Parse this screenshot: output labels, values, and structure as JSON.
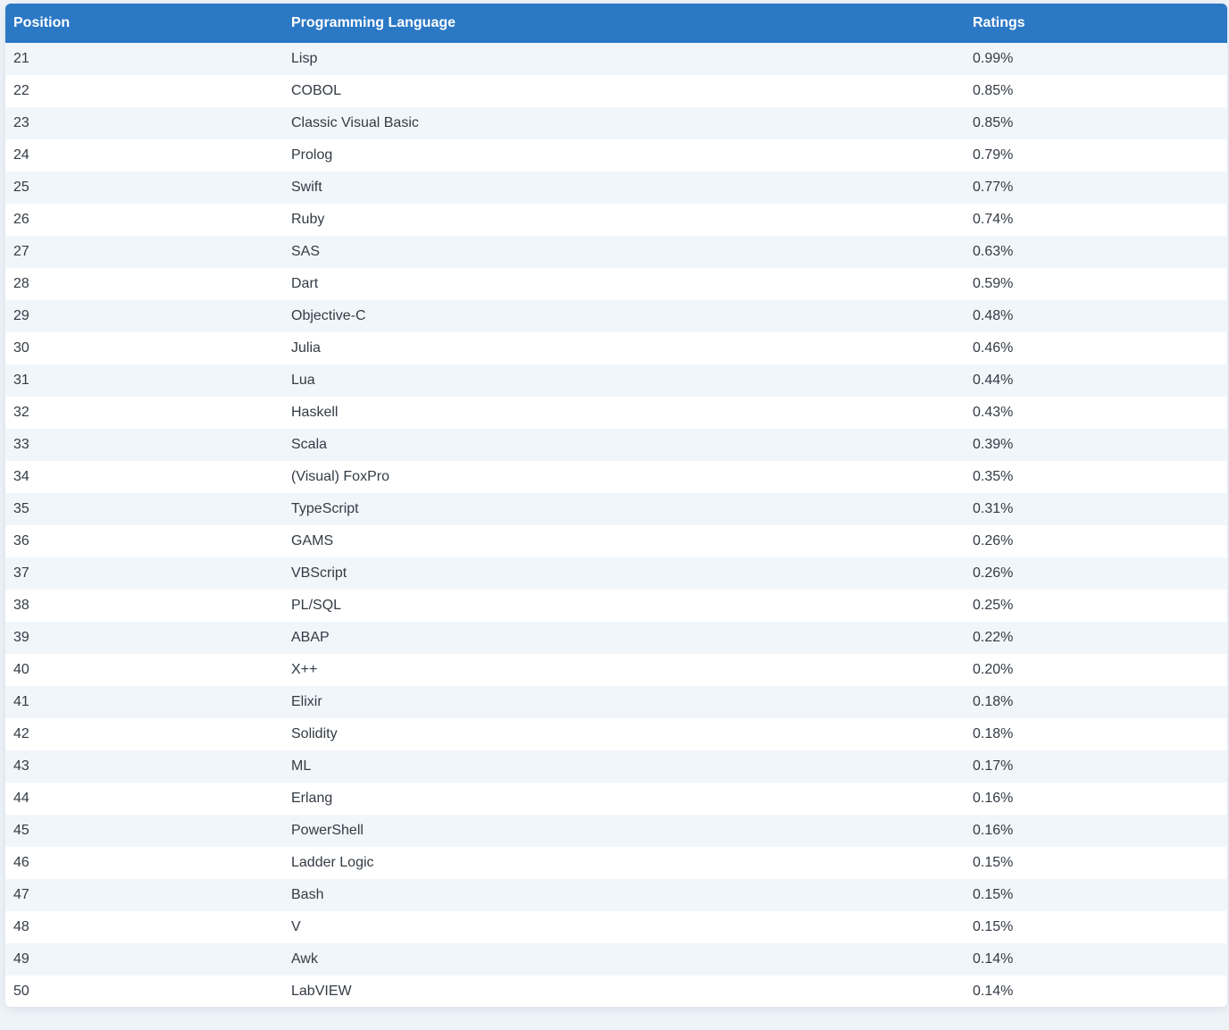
{
  "table": {
    "headers": [
      "Position",
      "Programming Language",
      "Ratings"
    ],
    "rows": [
      {
        "position": "21",
        "language": "Lisp",
        "rating": "0.99%"
      },
      {
        "position": "22",
        "language": "COBOL",
        "rating": "0.85%"
      },
      {
        "position": "23",
        "language": "Classic Visual Basic",
        "rating": "0.85%"
      },
      {
        "position": "24",
        "language": "Prolog",
        "rating": "0.79%"
      },
      {
        "position": "25",
        "language": "Swift",
        "rating": "0.77%"
      },
      {
        "position": "26",
        "language": "Ruby",
        "rating": "0.74%"
      },
      {
        "position": "27",
        "language": "SAS",
        "rating": "0.63%"
      },
      {
        "position": "28",
        "language": "Dart",
        "rating": "0.59%"
      },
      {
        "position": "29",
        "language": "Objective-C",
        "rating": "0.48%"
      },
      {
        "position": "30",
        "language": "Julia",
        "rating": "0.46%"
      },
      {
        "position": "31",
        "language": "Lua",
        "rating": "0.44%"
      },
      {
        "position": "32",
        "language": "Haskell",
        "rating": "0.43%"
      },
      {
        "position": "33",
        "language": "Scala",
        "rating": "0.39%"
      },
      {
        "position": "34",
        "language": "(Visual) FoxPro",
        "rating": "0.35%"
      },
      {
        "position": "35",
        "language": "TypeScript",
        "rating": "0.31%"
      },
      {
        "position": "36",
        "language": "GAMS",
        "rating": "0.26%"
      },
      {
        "position": "37",
        "language": "VBScript",
        "rating": "0.26%"
      },
      {
        "position": "38",
        "language": "PL/SQL",
        "rating": "0.25%"
      },
      {
        "position": "39",
        "language": "ABAP",
        "rating": "0.22%"
      },
      {
        "position": "40",
        "language": "X++",
        "rating": "0.20%"
      },
      {
        "position": "41",
        "language": "Elixir",
        "rating": "0.18%"
      },
      {
        "position": "42",
        "language": "Solidity",
        "rating": "0.18%"
      },
      {
        "position": "43",
        "language": "ML",
        "rating": "0.17%"
      },
      {
        "position": "44",
        "language": "Erlang",
        "rating": "0.16%"
      },
      {
        "position": "45",
        "language": "PowerShell",
        "rating": "0.16%"
      },
      {
        "position": "46",
        "language": "Ladder Logic",
        "rating": "0.15%"
      },
      {
        "position": "47",
        "language": "Bash",
        "rating": "0.15%"
      },
      {
        "position": "48",
        "language": "V",
        "rating": "0.15%"
      },
      {
        "position": "49",
        "language": "Awk",
        "rating": "0.14%"
      },
      {
        "position": "50",
        "language": "LabVIEW",
        "rating": "0.14%"
      }
    ]
  },
  "colors": {
    "header_background": "#2b78c5",
    "header_text": "#ffffff",
    "row_striped": "#f1f6fb",
    "row_plain": "#ffffff",
    "cell_text": "#333b44",
    "page_background": "#eef3f8"
  }
}
